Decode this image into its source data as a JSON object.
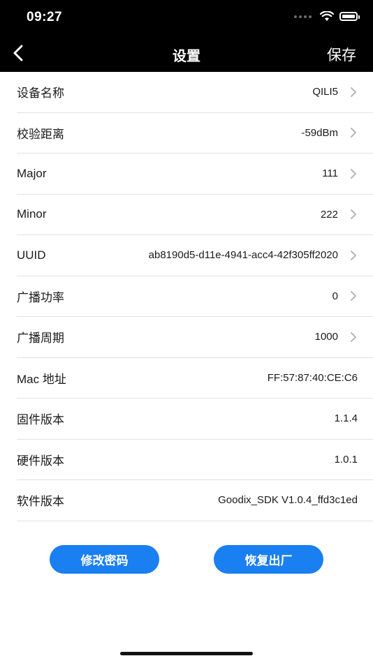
{
  "status_bar": {
    "time": "09:27"
  },
  "nav": {
    "title": "设置",
    "save_label": "保存"
  },
  "rows": [
    {
      "label": "设备名称",
      "value": "QILI5",
      "arrow": true
    },
    {
      "label": "校验距离",
      "value": "-59dBm",
      "arrow": true
    },
    {
      "label": "Major",
      "value": "111",
      "arrow": true
    },
    {
      "label": "Minor",
      "value": "222",
      "arrow": true
    },
    {
      "label": "UUID",
      "value": "ab8190d5-d11e-4941-acc4-42f305ff2020",
      "arrow": true
    },
    {
      "label": "广播功率",
      "value": "0",
      "arrow": true
    },
    {
      "label": "广播周期",
      "value": "1000",
      "arrow": true
    },
    {
      "label": "Mac 地址",
      "value": "FF:57:87:40:CE:C6",
      "arrow": false
    },
    {
      "label": "固件版本",
      "value": "1.1.4",
      "arrow": false
    },
    {
      "label": "硬件版本",
      "value": "1.0.1",
      "arrow": false
    },
    {
      "label": "软件版本",
      "value": "Goodix_SDK V1.0.4_ffd3c1ed",
      "arrow": false
    }
  ],
  "buttons": {
    "change_password": "修改密码",
    "factory_reset": "恢复出厂"
  },
  "colors": {
    "accent": "#1a7ff0",
    "header_bg": "#000000",
    "divider": "#e2e2e2"
  }
}
